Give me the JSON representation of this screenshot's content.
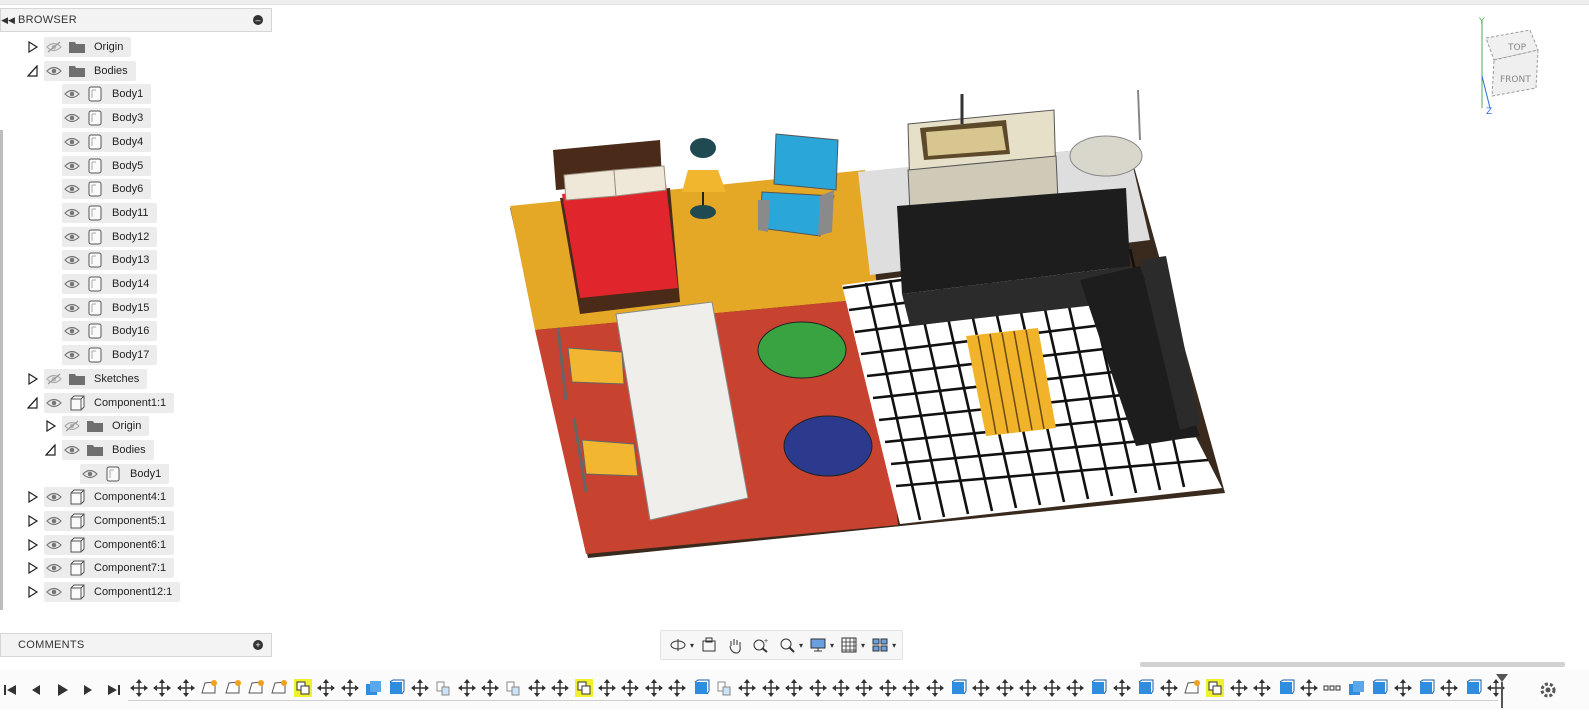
{
  "browser": {
    "title": "BROWSER",
    "tree": [
      {
        "label": "Origin",
        "type": "folder",
        "level": 0,
        "expander": "collapsed",
        "visible": false
      },
      {
        "label": "Bodies",
        "type": "folder",
        "level": 0,
        "expander": "expanded",
        "visible": true
      },
      {
        "label": "Body1",
        "type": "body",
        "level": 1,
        "expander": "none",
        "visible": true
      },
      {
        "label": "Body3",
        "type": "body",
        "level": 1,
        "expander": "none",
        "visible": true
      },
      {
        "label": "Body4",
        "type": "body",
        "level": 1,
        "expander": "none",
        "visible": true
      },
      {
        "label": "Body5",
        "type": "body",
        "level": 1,
        "expander": "none",
        "visible": true
      },
      {
        "label": "Body6",
        "type": "body",
        "level": 1,
        "expander": "none",
        "visible": true
      },
      {
        "label": "Body11",
        "type": "body",
        "level": 1,
        "expander": "none",
        "visible": true
      },
      {
        "label": "Body12",
        "type": "body",
        "level": 1,
        "expander": "none",
        "visible": true
      },
      {
        "label": "Body13",
        "type": "body",
        "level": 1,
        "expander": "none",
        "visible": true
      },
      {
        "label": "Body14",
        "type": "body",
        "level": 1,
        "expander": "none",
        "visible": true
      },
      {
        "label": "Body15",
        "type": "body",
        "level": 1,
        "expander": "none",
        "visible": true
      },
      {
        "label": "Body16",
        "type": "body",
        "level": 1,
        "expander": "none",
        "visible": true
      },
      {
        "label": "Body17",
        "type": "body",
        "level": 1,
        "expander": "none",
        "visible": true
      },
      {
        "label": "Sketches",
        "type": "folder",
        "level": 0,
        "expander": "collapsed",
        "visible": false
      },
      {
        "label": "Component1:1",
        "type": "component",
        "level": 0,
        "expander": "expanded",
        "visible": true
      },
      {
        "label": "Origin",
        "type": "folder",
        "level": 1,
        "expander": "collapsed",
        "visible": false
      },
      {
        "label": "Bodies",
        "type": "folder",
        "level": 1,
        "expander": "expanded",
        "visible": true
      },
      {
        "label": "Body1",
        "type": "body",
        "level": 2,
        "expander": "none",
        "visible": true
      },
      {
        "label": "Component4:1",
        "type": "component",
        "level": 0,
        "expander": "collapsed",
        "visible": true
      },
      {
        "label": "Component5:1",
        "type": "component",
        "level": 0,
        "expander": "collapsed",
        "visible": true
      },
      {
        "label": "Component6:1",
        "type": "component",
        "level": 0,
        "expander": "collapsed",
        "visible": true
      },
      {
        "label": "Component7:1",
        "type": "component",
        "level": 0,
        "expander": "collapsed",
        "visible": true
      },
      {
        "label": "Component12:1",
        "type": "component",
        "level": 0,
        "expander": "collapsed",
        "visible": true
      }
    ]
  },
  "comments": {
    "title": "COMMENTS"
  },
  "viewcube": {
    "top": "TOP",
    "front": "FRONT",
    "axis_y": "Y",
    "axis_z": "Z"
  },
  "nav_tools": [
    "orbit-icon",
    "look-at-icon",
    "pan-icon",
    "zoom-icon",
    "fit-icon",
    "display-settings-icon",
    "grid-settings-icon",
    "viewports-icon"
  ],
  "timeline": {
    "controls": [
      "go-to-start-icon",
      "step-back-icon",
      "play-icon",
      "step-forward-icon",
      "go-to-end-icon"
    ],
    "features": [
      "move",
      "move",
      "move",
      "sketch",
      "sketch",
      "sketch",
      "sketch",
      "combine",
      "move",
      "move",
      "extrude",
      "box",
      "move",
      "joint",
      "move",
      "move",
      "joint",
      "move",
      "move",
      "combine",
      "move",
      "move",
      "move",
      "move",
      "box",
      "joint",
      "move",
      "move",
      "move",
      "move",
      "move",
      "move",
      "move",
      "move",
      "move",
      "box",
      "move",
      "move",
      "move",
      "move",
      "move",
      "box",
      "move",
      "box",
      "move",
      "sketch",
      "combine",
      "move",
      "move",
      "box",
      "move",
      "pattern",
      "extrude",
      "box",
      "move",
      "box",
      "move",
      "box",
      "move"
    ],
    "colors": {
      "highlight": "#f0f030",
      "accent": "#2f8de0"
    }
  }
}
